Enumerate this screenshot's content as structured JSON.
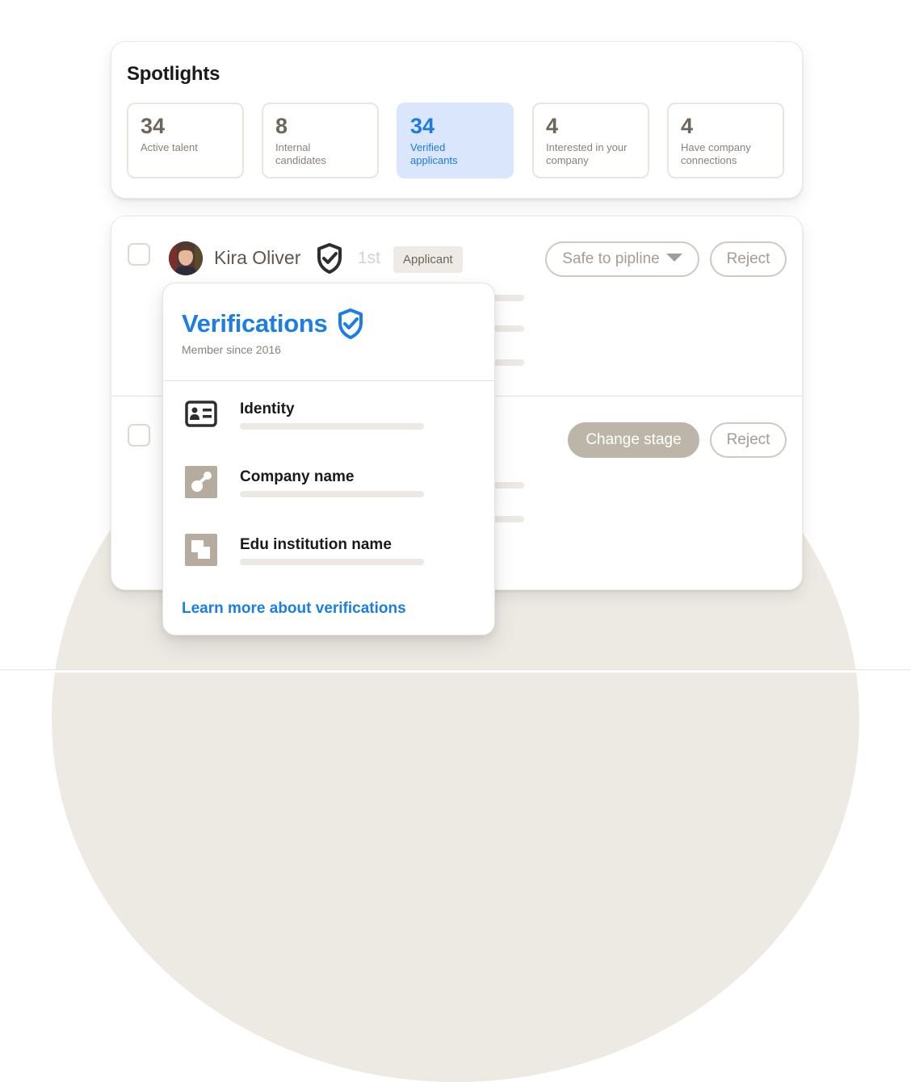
{
  "spotlights": {
    "title": "Spotlights",
    "stats": [
      {
        "number": "34",
        "label": "Active talent",
        "active": false
      },
      {
        "number": "8",
        "label": "Internal candidates",
        "active": false
      },
      {
        "number": "34",
        "label": "Verified applicants",
        "active": true
      },
      {
        "number": "4",
        "label": "Interested in your company",
        "active": false
      },
      {
        "number": "4",
        "label": "Have company connections",
        "active": false
      }
    ]
  },
  "candidate": {
    "name": "Kira Oliver",
    "degree": "1st",
    "tag": "Applicant",
    "primary_action": "Safe to pipline",
    "reject_label": "Reject"
  },
  "second_row": {
    "change_stage_label": "Change stage",
    "reject_label": "Reject"
  },
  "verifications": {
    "title": "Verifications",
    "member_since": "Member since 2016",
    "items": [
      {
        "label": "Identity",
        "icon": "id-card-icon"
      },
      {
        "label": "Company name",
        "icon": "company-logo-icon"
      },
      {
        "label": "Edu institution name",
        "icon": "edu-logo-icon"
      }
    ],
    "learn_more": "Learn more about verifications"
  },
  "colors": {
    "accent_blue": "#1a7ee6",
    "active_tile_bg": "#d9e6fb",
    "muted_brown": "#6e655b",
    "button_fill": "#bdb5a8"
  }
}
